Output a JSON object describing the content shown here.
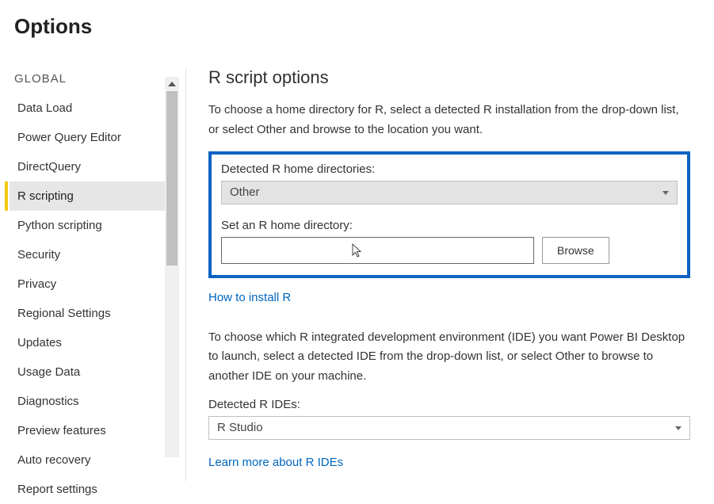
{
  "page_title": "Options",
  "sidebar": {
    "heading": "GLOBAL",
    "items": [
      {
        "label": "Data Load",
        "active": false
      },
      {
        "label": "Power Query Editor",
        "active": false
      },
      {
        "label": "DirectQuery",
        "active": false
      },
      {
        "label": "R scripting",
        "active": true
      },
      {
        "label": "Python scripting",
        "active": false
      },
      {
        "label": "Security",
        "active": false
      },
      {
        "label": "Privacy",
        "active": false
      },
      {
        "label": "Regional Settings",
        "active": false
      },
      {
        "label": "Updates",
        "active": false
      },
      {
        "label": "Usage Data",
        "active": false
      },
      {
        "label": "Diagnostics",
        "active": false
      },
      {
        "label": "Preview features",
        "active": false
      },
      {
        "label": "Auto recovery",
        "active": false
      },
      {
        "label": "Report settings",
        "active": false
      }
    ]
  },
  "content": {
    "section_title": "R script options",
    "desc1": "To choose a home directory for R, select a detected R installation from the drop-down list, or select Other and browse to the location you want.",
    "detected_label": "Detected R home directories:",
    "detected_value": "Other",
    "setdir_label": "Set an R home directory:",
    "setdir_value": "",
    "browse_label": "Browse",
    "install_link": "How to install R",
    "desc2": "To choose which R integrated development environment (IDE) you want Power BI Desktop to launch, select a detected IDE from the drop-down list, or select Other to browse to another IDE on your machine.",
    "ide_label": "Detected R IDEs:",
    "ide_value": "R Studio",
    "ide_link": "Learn more about R IDEs"
  }
}
